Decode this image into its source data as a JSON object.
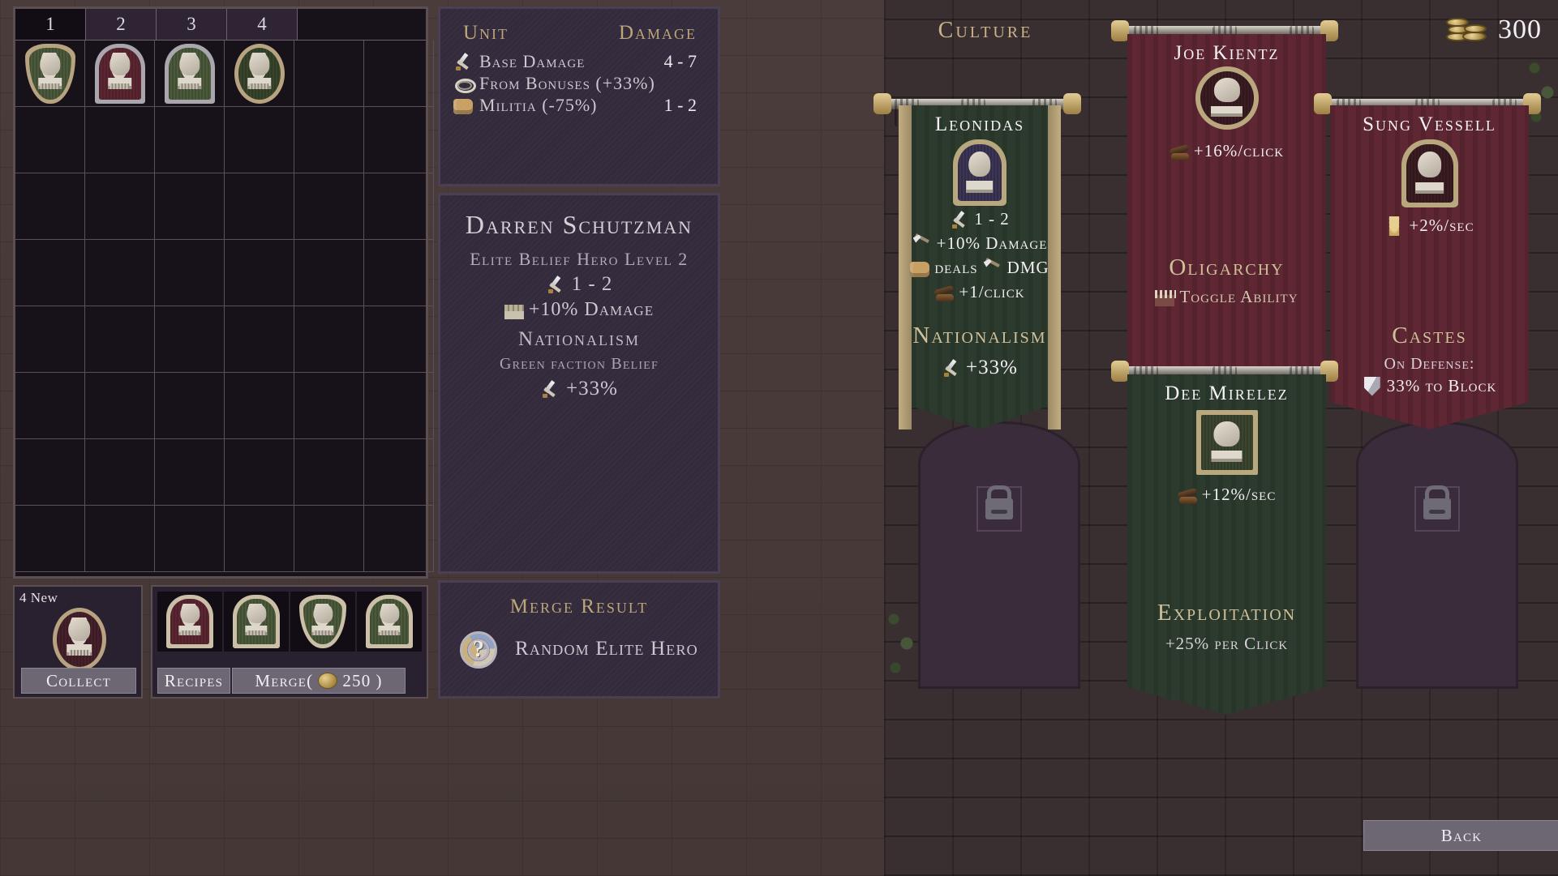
{
  "inventory": {
    "tabs": [
      "1",
      "2",
      "3",
      "4"
    ],
    "grid_columns": 6,
    "grid_rows": 8,
    "items": [
      {
        "slot": 0,
        "frame": "shield",
        "frame_color": "#b8a381",
        "bg": "#4b5a3a"
      },
      {
        "slot": 1,
        "frame": "arch",
        "frame_color": "#a9a6ad",
        "bg": "#5b2632"
      },
      {
        "slot": 2,
        "frame": "arch",
        "frame_color": "#a9a6ad",
        "bg": "#4b5a3a"
      },
      {
        "slot": 3,
        "frame": "circle",
        "frame_color": "#b8a381",
        "bg": "#38452c"
      }
    ]
  },
  "collect": {
    "new_label": "4 New",
    "button_label": "Collect",
    "pending": {
      "frame": "circle",
      "frame_color": "#b8a381",
      "bg": "#46202a"
    }
  },
  "recipes": {
    "recipes_label": "Recipes",
    "merge_label": "Merge(",
    "merge_cost": "250",
    "merge_close": ")",
    "slots": [
      {
        "frame": "arch",
        "frame_color": "#cbbfa7",
        "bg": "#5b2632"
      },
      {
        "frame": "arch",
        "frame_color": "#cbbfa7",
        "bg": "#4b5a3a"
      },
      {
        "frame": "shield",
        "frame_color": "#cbbfa7",
        "bg": "#4b5a3a"
      },
      {
        "frame": "arch",
        "frame_color": "#cbbfa7",
        "bg": "#4b5a3a"
      }
    ]
  },
  "unit_card": {
    "col_unit": "Unit",
    "col_damage": "Damage",
    "rows": [
      {
        "icon": "sword-icon",
        "label": "Base Damage",
        "value": "4 - 7"
      },
      {
        "icon": "ring-icon",
        "label": "From Bonuses (+33%)",
        "value": ""
      },
      {
        "icon": "fist-icon",
        "label": "Militia (-75%)",
        "value": "1 - 2"
      }
    ]
  },
  "hero_card": {
    "name": "Darren Schutzman",
    "subtitle": "Elite Belief Hero Level 2",
    "stats": [
      {
        "icon": "sword-icon",
        "text": "1 - 2"
      },
      {
        "icon": "wall-icon",
        "text": "+10% Damage"
      }
    ],
    "belief_name": "Nationalism",
    "belief_desc": "Green faction Belief",
    "belief_stat": {
      "icon": "sword-icon",
      "text": "+33%"
    }
  },
  "merge_card": {
    "title": "Merge Result",
    "icon": "question-mark-icon",
    "result": "Random Elite Hero"
  },
  "culture": {
    "title": "Culture",
    "gold": "300",
    "back_label": "Back",
    "banners": [
      {
        "id": "leonidas",
        "hero": "Leonidas",
        "cloth": "#2d3b2e",
        "portrait_frame": "#b9a87e",
        "portrait_bg": "#3c3555",
        "stats": [
          {
            "icon": "sword-icon",
            "text": "1 - 2"
          },
          {
            "icon": "spear-icon",
            "text": "+10% Damage"
          },
          {
            "icon": "fist-icon",
            "text": "deals",
            "icon2": "spear-icon",
            "text2": "DMG"
          },
          {
            "icon": "logs-icon",
            "text": "+1/click"
          }
        ],
        "belief_title": "Nationalism",
        "belief_stat": {
          "icon": "sword-icon",
          "text": "+33%"
        }
      },
      {
        "id": "joe-kientz",
        "hero": "Joe Kientz",
        "cloth": "#5e2733",
        "portrait_frame": "#b9a87e",
        "portrait_bg": "#3a1c22",
        "stats": [
          {
            "icon": "logs-icon",
            "text": "+16%/click"
          }
        ],
        "belief_title": "Oligarchy",
        "belief_ability": {
          "icon": "crowd-icon",
          "text": "Toggle Ability"
        }
      },
      {
        "id": "sung-vessell",
        "hero": "Sung Vessell",
        "cloth": "#5e2733",
        "portrait_frame": "#b9a87e",
        "portrait_bg": "#3a1c22",
        "stats": [
          {
            "icon": "wheat-icon",
            "text": "+2%/sec"
          }
        ],
        "belief_title": "Castes",
        "belief_line1": "On Defense:",
        "belief_stat": {
          "icon": "shield-icon",
          "text": "33% to Block"
        }
      },
      {
        "id": "dee-mirelez",
        "hero": "Dee Mirelez",
        "cloth": "#2d3b2e",
        "portrait_frame": "#b9a87e",
        "portrait_bg": "#3b4530",
        "stats": [
          {
            "icon": "logs-icon",
            "text": "+12%/sec"
          }
        ],
        "belief_title": "Exploitation",
        "belief_line1": "+25% per Click"
      }
    ],
    "locked_slots": 2
  }
}
